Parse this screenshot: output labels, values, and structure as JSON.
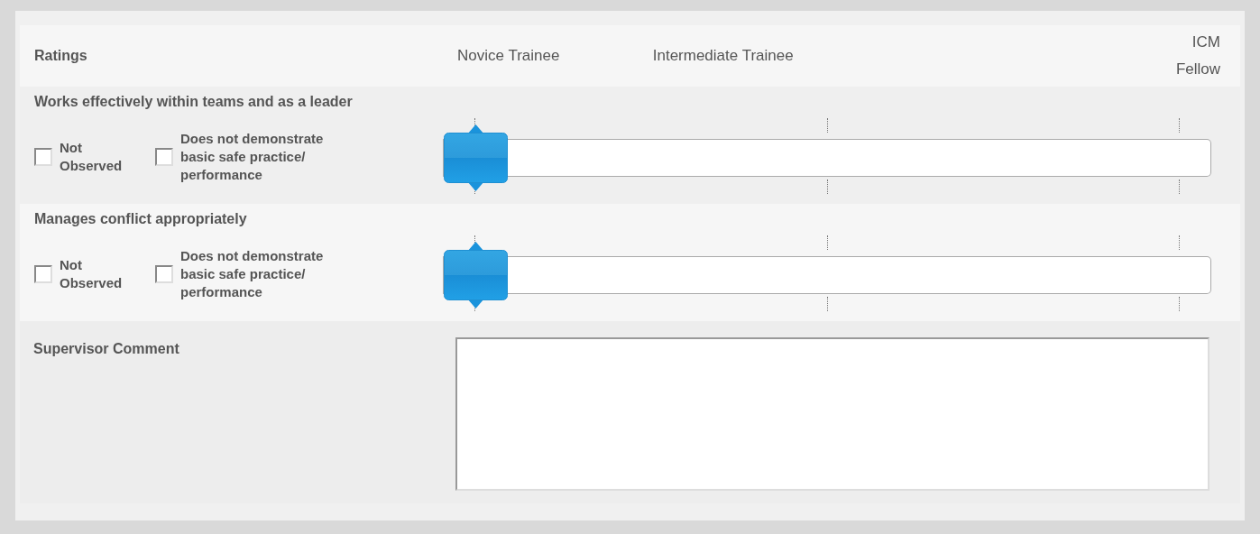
{
  "header": {
    "title": "Ratings",
    "scale_labels": [
      "Novice Trainee",
      "Intermediate Trainee",
      "ICM Fellow"
    ]
  },
  "ratings": [
    {
      "title": "Works effectively within teams and as a leader",
      "checkboxes": [
        {
          "label": "Not Observed",
          "checked": false
        },
        {
          "label": "Does not demonstrate basic safe practice/ performance",
          "checked": false
        }
      ],
      "level": 0
    },
    {
      "title": "Manages conflict appropriately",
      "checkboxes": [
        {
          "label": "Not Observed",
          "checked": false
        },
        {
          "label": "Does not demonstrate basic safe practice/ performance",
          "checked": false
        }
      ],
      "level": 0
    }
  ],
  "comment": {
    "label": "Supervisor Comment"
  }
}
